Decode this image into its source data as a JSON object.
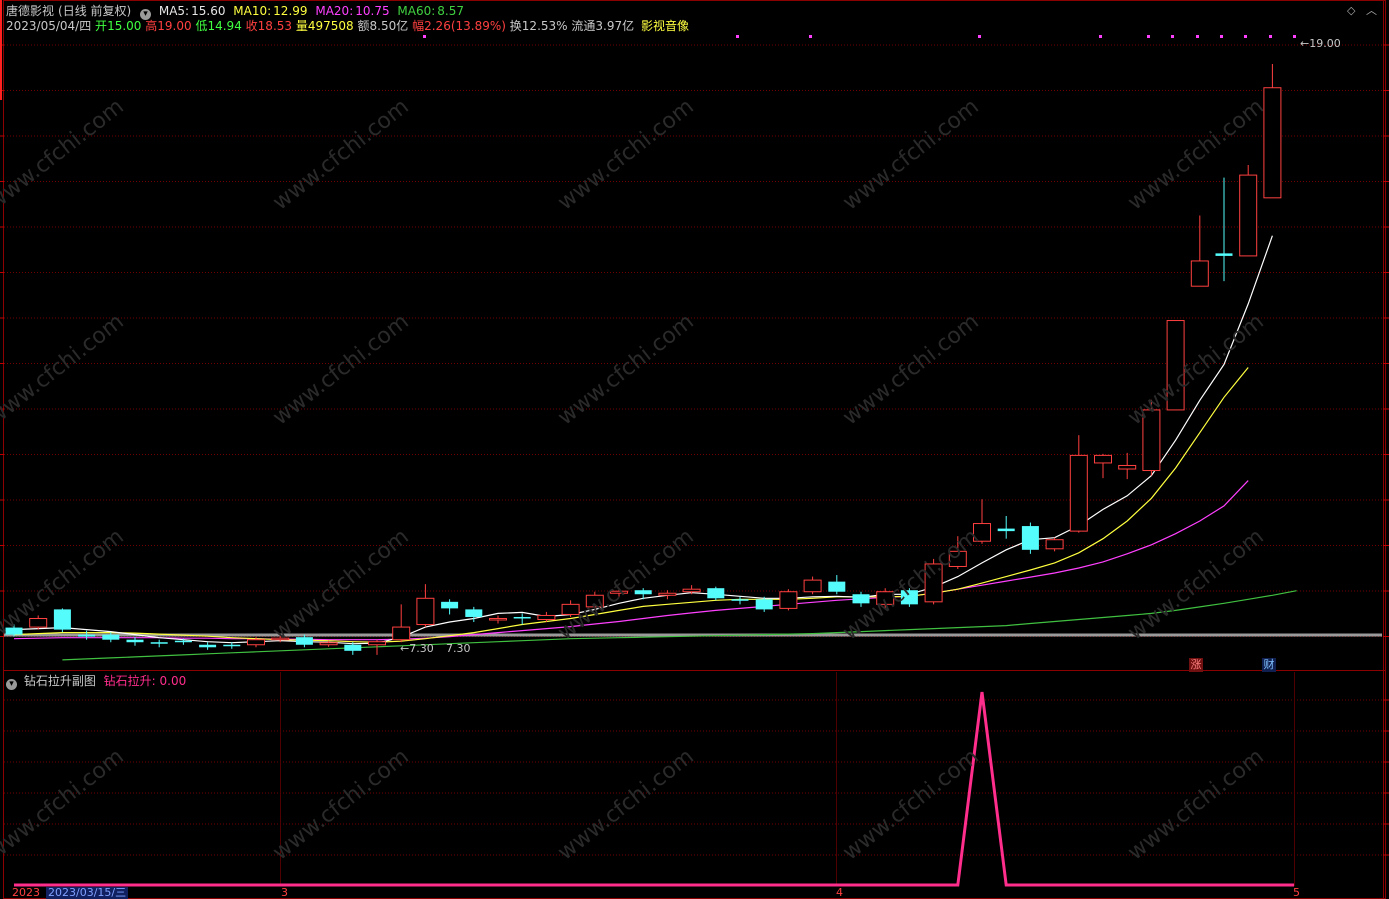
{
  "header": {
    "stock_name": "唐德影视",
    "period": "(日线 前复权)",
    "ma5_label": "MA5:",
    "ma5_value": "15.60",
    "ma10_label": "MA10:",
    "ma10_value": "12.99",
    "ma20_label": "MA20:",
    "ma20_value": "10.75",
    "ma60_label": "MA60:",
    "ma60_value": "8.57"
  },
  "info": {
    "date": "2023/05/04/四",
    "open_label": "开",
    "open": "15.00",
    "high_label": "高",
    "high": "19.00",
    "low_label": "低",
    "low": "14.94",
    "close_label": "收",
    "close": "18.53",
    "volume_label": "量",
    "volume": "497508",
    "amount_label": "额",
    "amount": "8.50亿",
    "change_label": "幅",
    "change": "2.26(13.89%)",
    "turnover_label": "换",
    "turnover": "12.53%",
    "float_label": "流通",
    "float": "3.97亿",
    "sector": "影视音像"
  },
  "annotations": {
    "max_price": "19.00",
    "min_price_left": "7.30",
    "min_price_right": "7.30",
    "badge_zhang": "涨",
    "badge_cai": "财"
  },
  "sub_panel": {
    "title": "钻石拉升副图",
    "indicator_label": "钻石拉升:",
    "indicator_value": "0.00"
  },
  "axis": {
    "date_left_year": "2023",
    "date_left_full": "2023/03/15/三",
    "month_3": "3",
    "month_4": "4",
    "month_5": "5"
  },
  "watermark": "www.cfchi.com",
  "colors": {
    "up": "#ff4040",
    "down": "#54fcfc",
    "ma5": "#ffffff",
    "ma10": "#ffff40",
    "ma20": "#ff40ff",
    "ma60": "#40c040",
    "indicator": "#ff2d8c",
    "grid": "#700000"
  },
  "chart_data": {
    "type": "candlestick",
    "price_range": [
      7.0,
      19.5
    ],
    "candles": [
      {
        "o": 7.84,
        "c": 7.7,
        "h": 7.9,
        "l": 7.66
      },
      {
        "o": 7.85,
        "c": 8.02,
        "h": 8.08,
        "l": 7.8
      },
      {
        "o": 8.2,
        "c": 7.8,
        "h": 8.22,
        "l": 7.75
      },
      {
        "o": 7.7,
        "c": 7.66,
        "h": 7.78,
        "l": 7.6
      },
      {
        "o": 7.7,
        "c": 7.6,
        "h": 7.75,
        "l": 7.55
      },
      {
        "o": 7.6,
        "c": 7.55,
        "h": 7.65,
        "l": 7.48
      },
      {
        "o": 7.55,
        "c": 7.52,
        "h": 7.6,
        "l": 7.45
      },
      {
        "o": 7.58,
        "c": 7.55,
        "h": 7.62,
        "l": 7.5
      },
      {
        "o": 7.5,
        "c": 7.45,
        "h": 7.55,
        "l": 7.4
      },
      {
        "o": 7.5,
        "c": 7.48,
        "h": 7.55,
        "l": 7.42
      },
      {
        "o": 7.5,
        "c": 7.6,
        "h": 7.65,
        "l": 7.45
      },
      {
        "o": 7.6,
        "c": 7.63,
        "h": 7.68,
        "l": 7.55
      },
      {
        "o": 7.65,
        "c": 7.5,
        "h": 7.7,
        "l": 7.45
      },
      {
        "o": 7.5,
        "c": 7.54,
        "h": 7.58,
        "l": 7.46
      },
      {
        "o": 7.5,
        "c": 7.38,
        "h": 7.55,
        "l": 7.3
      },
      {
        "o": 7.5,
        "c": 7.56,
        "h": 7.6,
        "l": 7.3
      },
      {
        "o": 7.6,
        "c": 7.85,
        "h": 8.3,
        "l": 7.55
      },
      {
        "o": 7.9,
        "c": 8.42,
        "h": 8.7,
        "l": 7.85
      },
      {
        "o": 8.35,
        "c": 8.22,
        "h": 8.4,
        "l": 8.1
      },
      {
        "o": 8.2,
        "c": 8.05,
        "h": 8.25,
        "l": 7.95
      },
      {
        "o": 8.0,
        "c": 8.02,
        "h": 8.08,
        "l": 7.92
      },
      {
        "o": 8.05,
        "c": 8.02,
        "h": 8.12,
        "l": 7.9
      },
      {
        "o": 8.0,
        "c": 8.08,
        "h": 8.15,
        "l": 7.95
      },
      {
        "o": 8.1,
        "c": 8.3,
        "h": 8.38,
        "l": 8.05
      },
      {
        "o": 8.25,
        "c": 8.48,
        "h": 8.55,
        "l": 8.2
      },
      {
        "o": 8.52,
        "c": 8.56,
        "h": 8.6,
        "l": 8.45
      },
      {
        "o": 8.58,
        "c": 8.5,
        "h": 8.62,
        "l": 8.4
      },
      {
        "o": 8.48,
        "c": 8.52,
        "h": 8.58,
        "l": 8.4
      },
      {
        "o": 8.55,
        "c": 8.6,
        "h": 8.68,
        "l": 8.5
      },
      {
        "o": 8.62,
        "c": 8.42,
        "h": 8.65,
        "l": 8.38
      },
      {
        "o": 8.4,
        "c": 8.38,
        "h": 8.45,
        "l": 8.3
      },
      {
        "o": 8.4,
        "c": 8.2,
        "h": 8.45,
        "l": 8.15
      },
      {
        "o": 8.22,
        "c": 8.55,
        "h": 8.6,
        "l": 8.18
      },
      {
        "o": 8.55,
        "c": 8.78,
        "h": 8.85,
        "l": 8.5
      },
      {
        "o": 8.75,
        "c": 8.55,
        "h": 8.88,
        "l": 8.5
      },
      {
        "o": 8.5,
        "c": 8.32,
        "h": 8.55,
        "l": 8.25
      },
      {
        "o": 8.3,
        "c": 8.55,
        "h": 8.62,
        "l": 8.2
      },
      {
        "o": 8.58,
        "c": 8.3,
        "h": 8.62,
        "l": 8.25
      },
      {
        "o": 8.35,
        "c": 9.1,
        "h": 9.2,
        "l": 8.3
      },
      {
        "o": 9.05,
        "c": 9.35,
        "h": 9.65,
        "l": 9.0
      },
      {
        "o": 9.55,
        "c": 9.9,
        "h": 10.38,
        "l": 9.5
      },
      {
        "o": 9.8,
        "c": 9.75,
        "h": 10.05,
        "l": 9.6
      },
      {
        "o": 9.85,
        "c": 9.38,
        "h": 9.92,
        "l": 9.3
      },
      {
        "o": 9.4,
        "c": 9.58,
        "h": 9.62,
        "l": 9.35
      },
      {
        "o": 9.75,
        "c": 11.25,
        "h": 11.65,
        "l": 9.72
      },
      {
        "o": 11.1,
        "c": 11.25,
        "h": 11.28,
        "l": 10.8
      },
      {
        "o": 10.98,
        "c": 11.05,
        "h": 11.3,
        "l": 10.78
      },
      {
        "o": 10.95,
        "c": 12.15,
        "h": 12.35,
        "l": 10.85
      },
      {
        "o": 12.15,
        "c": 13.92,
        "h": 13.92,
        "l": 12.15
      },
      {
        "o": 14.6,
        "c": 15.1,
        "h": 16.0,
        "l": 14.6
      },
      {
        "o": 15.25,
        "c": 15.2,
        "h": 16.75,
        "l": 14.7
      },
      {
        "o": 15.2,
        "c": 16.8,
        "h": 17.0,
        "l": 15.2
      },
      {
        "o": 16.35,
        "c": 18.53,
        "h": 19.0,
        "l": 16.35
      }
    ],
    "ma5": [
      7.8,
      7.82,
      7.84,
      7.8,
      7.76,
      7.7,
      7.64,
      7.6,
      7.56,
      7.54,
      7.56,
      7.58,
      7.56,
      7.55,
      7.52,
      7.53,
      7.65,
      7.85,
      7.95,
      8.02,
      8.12,
      8.14,
      8.06,
      8.1,
      8.2,
      8.32,
      8.42,
      8.48,
      8.53,
      8.5,
      8.46,
      8.42,
      8.42,
      8.45,
      8.46,
      8.44,
      8.5,
      8.5,
      8.64,
      8.85,
      9.12,
      9.38,
      9.58,
      9.62,
      9.86,
      10.18,
      10.45,
      10.85,
      11.55,
      12.34,
      13.05,
      14.25,
      15.6
    ],
    "ma10": [
      7.7,
      7.72,
      7.74,
      7.74,
      7.74,
      7.73,
      7.71,
      7.69,
      7.67,
      7.64,
      7.62,
      7.6,
      7.59,
      7.58,
      7.56,
      7.55,
      7.57,
      7.62,
      7.68,
      7.74,
      7.82,
      7.9,
      7.96,
      8.02,
      8.1,
      8.18,
      8.26,
      8.3,
      8.34,
      8.38,
      8.4,
      8.4,
      8.4,
      8.42,
      8.45,
      8.45,
      8.45,
      8.46,
      8.52,
      8.6,
      8.72,
      8.85,
      8.98,
      9.12,
      9.32,
      9.6,
      9.95,
      10.4,
      11.0,
      11.7,
      12.4,
      12.99
    ],
    "ma20": [
      7.62,
      7.63,
      7.64,
      7.64,
      7.64,
      7.64,
      7.64,
      7.63,
      7.63,
      7.62,
      7.62,
      7.61,
      7.61,
      7.6,
      7.6,
      7.6,
      7.61,
      7.63,
      7.66,
      7.7,
      7.74,
      7.78,
      7.82,
      7.86,
      7.91,
      7.96,
      8.02,
      8.08,
      8.13,
      8.18,
      8.22,
      8.26,
      8.3,
      8.34,
      8.38,
      8.41,
      8.44,
      8.46,
      8.52,
      8.6,
      8.68,
      8.76,
      8.84,
      8.92,
      9.02,
      9.14,
      9.3,
      9.48,
      9.7,
      9.95,
      10.25,
      10.75
    ],
    "ma60": [
      7.2,
      7.22,
      7.24,
      7.26,
      7.28,
      7.3,
      7.32,
      7.34,
      7.36,
      7.38,
      7.4,
      7.42,
      7.44,
      7.46,
      7.48,
      7.5,
      7.52,
      7.54,
      7.56,
      7.58,
      7.6,
      7.62,
      7.63,
      7.64,
      7.65,
      7.66,
      7.67,
      7.68,
      7.69,
      7.7,
      7.71,
      7.72,
      7.74,
      7.76,
      7.78,
      7.8,
      7.82,
      7.84,
      7.86,
      7.88,
      7.92,
      7.96,
      8.0,
      8.04,
      8.08,
      8.12,
      8.18,
      8.25,
      8.32,
      8.4,
      8.48,
      8.57
    ],
    "ma5_start_index": 0,
    "ma60_start_index": 1,
    "indicator": {
      "name": "钻石拉升",
      "values": [
        0,
        0,
        0,
        0,
        0,
        0,
        0,
        0,
        0,
        0,
        0,
        0,
        0,
        0,
        0,
        0,
        0,
        0,
        0,
        0,
        0,
        0,
        0,
        0,
        0,
        0,
        0,
        0,
        0,
        0,
        0,
        0,
        0,
        0,
        0,
        0,
        0,
        0,
        0,
        0,
        1,
        0,
        0,
        0,
        0,
        0,
        0,
        0,
        0,
        0,
        0,
        0,
        0
      ]
    }
  }
}
